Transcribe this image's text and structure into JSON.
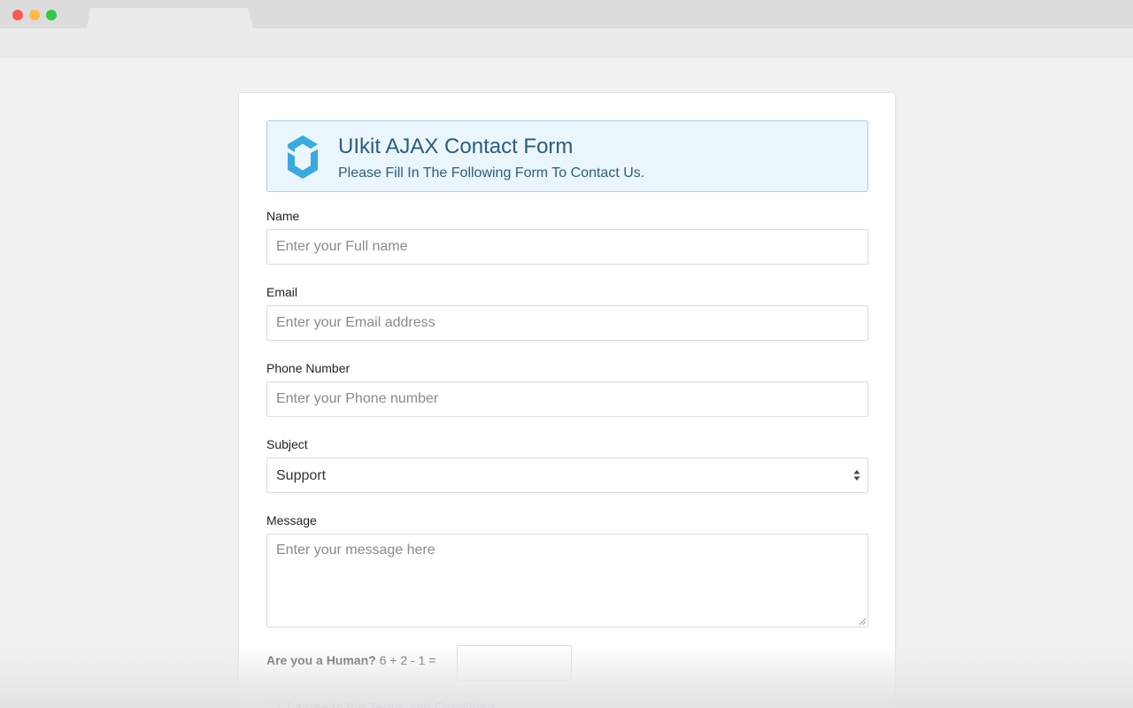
{
  "header": {
    "title": "UIkit AJAX Contact Form",
    "subtitle": "Please Fill In The Following Form To Contact Us."
  },
  "form": {
    "name": {
      "label": "Name",
      "placeholder": "Enter your Full name"
    },
    "email": {
      "label": "Email",
      "placeholder": "Enter your Email address"
    },
    "phone": {
      "label": "Phone Number",
      "placeholder": "Enter your Phone number"
    },
    "subject": {
      "label": "Subject",
      "value": "Support"
    },
    "message": {
      "label": "Message",
      "placeholder": "Enter your message here"
    },
    "captcha": {
      "question": "Are you a Human?",
      "equation": "6 + 2 - 1 ="
    },
    "agree": {
      "text": "I agree to the",
      "link": "Terms and Conditions"
    }
  },
  "colors": {
    "accent": "#1e87f0",
    "logo": "#39a9e0",
    "header_bg": "#eaf5fc",
    "header_text": "#2c5d7f"
  },
  "icons": {
    "logo": "uikit-logo-icon",
    "select": "select-arrows-icon",
    "resize": "resize-grip-icon"
  }
}
